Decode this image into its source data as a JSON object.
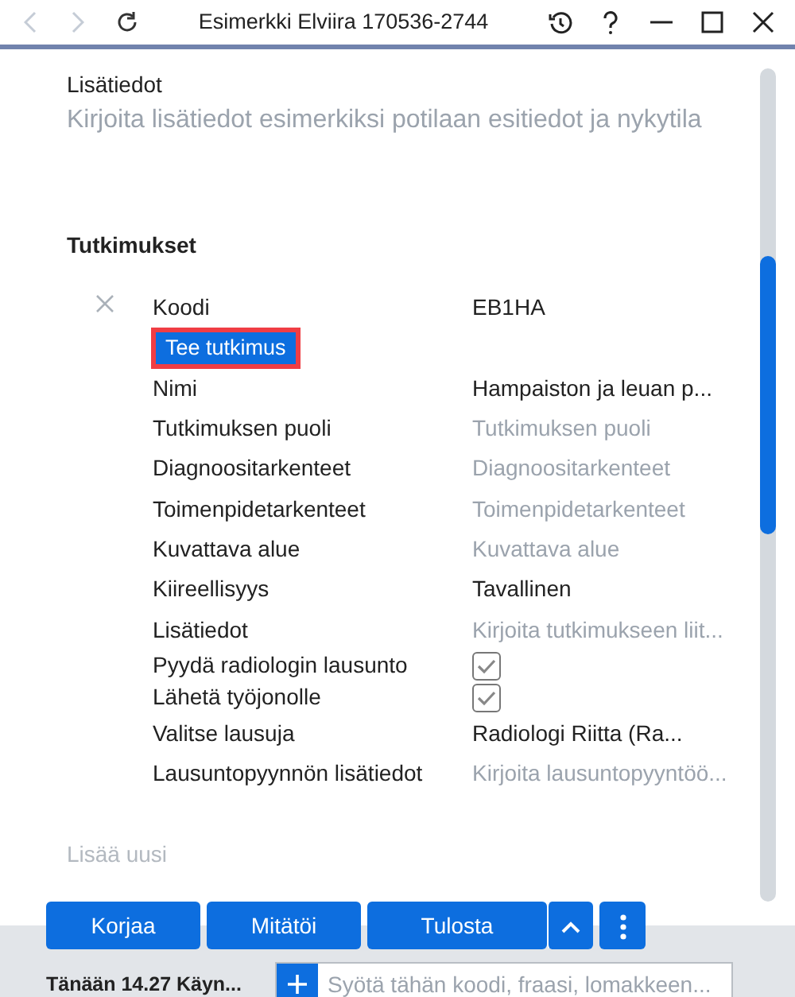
{
  "window": {
    "title": "Esimerkki Elviira 170536-2744"
  },
  "info": {
    "label": "Lisätiedot",
    "placeholder": "Kirjoita lisätiedot esimerkiksi potilaan esitiedot ja nykytila"
  },
  "section": {
    "title": "Tutkimukset",
    "action": "Tee tutkimus",
    "add_new": "Lisää uusi",
    "rows": [
      {
        "kind": "text",
        "label": "Koodi",
        "value": "EB1HA"
      },
      {
        "kind": "action"
      },
      {
        "kind": "text",
        "label": "Nimi",
        "value": "Hampaiston ja leuan p..."
      },
      {
        "kind": "field",
        "label": "Tutkimuksen puoli",
        "placeholder": "Tutkimuksen puoli"
      },
      {
        "kind": "field",
        "label": "Diagnoositarkenteet",
        "placeholder": "Diagnoositarkenteet"
      },
      {
        "kind": "field",
        "label": "Toimenpidetarkenteet",
        "placeholder": "Toimenpidetarkenteet"
      },
      {
        "kind": "field",
        "label": "Kuvattava alue",
        "placeholder": "Kuvattava alue"
      },
      {
        "kind": "text",
        "label": "Kiireellisyys",
        "value": "Tavallinen"
      },
      {
        "kind": "field",
        "label": "Lisätiedot",
        "placeholder": "Kirjoita tutkimukseen liit..."
      },
      {
        "kind": "checkbox",
        "label": "Pyydä radiologin lausunto",
        "checked": true
      },
      {
        "kind": "checkbox",
        "label": "Lähetä työjonolle",
        "checked": true
      },
      {
        "kind": "text",
        "label": "Valitse lausuja",
        "value": "Radiologi Riitta (Ra..."
      },
      {
        "kind": "field",
        "label": "Lausuntopyynnön lisätiedot",
        "placeholder": "Kirjoita lausuntopyyntöö..."
      }
    ]
  },
  "buttons": [
    "Korjaa",
    "Mitätöi",
    "Tulosta"
  ],
  "status": {
    "text": "Tänään 14.27 Käyn...",
    "placeholder": "Syötä tähän koodi, fraasi, lomakkeen..."
  }
}
